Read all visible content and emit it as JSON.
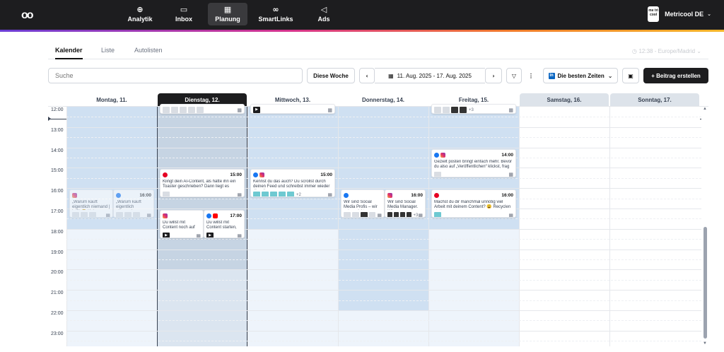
{
  "nav": {
    "items": [
      {
        "label": "Analytik",
        "icon": "analytics-icon",
        "glyph": "⊕"
      },
      {
        "label": "Inbox",
        "icon": "inbox-icon",
        "glyph": "▭"
      },
      {
        "label": "Planung",
        "icon": "calendar-icon",
        "glyph": "▦"
      },
      {
        "label": "SmartLinks",
        "icon": "link-icon",
        "glyph": "∞"
      },
      {
        "label": "Ads",
        "icon": "megaphone-icon",
        "glyph": "◁"
      }
    ],
    "active": "Planung"
  },
  "account": {
    "name": "Metricool DE",
    "logo_text": "me tri cool"
  },
  "tabs": [
    "Kalender",
    "Liste",
    "Autolisten"
  ],
  "timezone": "12:38 - Europe/Madrid",
  "toolbar": {
    "search_placeholder": "Suche",
    "this_week": "Diese Woche",
    "date_range": "11. Aug. 2025 - 17. Aug. 2025",
    "best_times": "Die besten Zeiten",
    "create_post": "+ Beitrag erstellen"
  },
  "days": [
    {
      "label": "Montag, 11.",
      "state": "normal"
    },
    {
      "label": "Dienstag, 12.",
      "state": "today"
    },
    {
      "label": "Mittwoch, 13.",
      "state": "normal"
    },
    {
      "label": "Donnerstag, 14.",
      "state": "normal"
    },
    {
      "label": "Freitag, 15.",
      "state": "normal"
    },
    {
      "label": "Samstag, 16.",
      "state": "weekend"
    },
    {
      "label": "Sonntag, 17.",
      "state": "weekend"
    }
  ],
  "hours": [
    "12:00",
    "13:00",
    "14:00",
    "15:00",
    "16:00",
    "17:00",
    "18:00",
    "19:00",
    "20:00",
    "21:00",
    "22:00",
    "23:00"
  ],
  "posts": [
    {
      "day": "Dienstag, 12.",
      "hour": "11:30",
      "networks": [],
      "time": "",
      "text": "",
      "thumbs": [
        "gray",
        "gray",
        "gray",
        "gray",
        "gray"
      ],
      "more": ""
    },
    {
      "day": "Mittwoch, 13.",
      "hour": "11:30",
      "networks": [],
      "time": "",
      "text": "",
      "thumbs": [
        "play"
      ],
      "more": ""
    },
    {
      "day": "Freitag, 15.",
      "hour": "11:30",
      "networks": [],
      "time": "",
      "text": "",
      "thumbs": [
        "gray",
        "gray",
        "dark",
        "dark"
      ],
      "more": "+3"
    },
    {
      "day": "Freitag, 15.",
      "hour": "14:00",
      "networks": [
        "fb",
        "ig"
      ],
      "time": "14:00",
      "text": "Gezielt posten bringt einfach mehr. Bevor du also auf „Veröffentlichen“ klickst, frag dich",
      "thumbs": [
        "gray"
      ],
      "more": ""
    },
    {
      "day": "Dienstag, 12.",
      "hour": "15:00",
      "networks": [
        "pin"
      ],
      "time": "15:00",
      "text": "Klingt dein AI-Content, als hätte ihn ein Toaster geschrieben? Dann liegt es",
      "thumbs": [
        "gray"
      ],
      "more": ""
    },
    {
      "day": "Mittwoch, 13.",
      "hour": "15:00",
      "networks": [
        "fb",
        "ig"
      ],
      "time": "15:00",
      "text": "Kennst du das auch? Du scrollst durch deinen Feed und schreibst immer wieder dieselben",
      "thumbs": [
        "teal",
        "teal",
        "teal",
        "teal",
        "teal"
      ],
      "more": "+2"
    },
    {
      "day": "Montag, 11.",
      "hour": "16:00",
      "networks": [
        "ig"
      ],
      "time": "",
      "text": "„Warum kauft eigentlich niemand | ist?“ 🤔 Kein",
      "thumbs": [
        "gray",
        "gray",
        "gray"
      ],
      "more": "",
      "faded": true,
      "half": "left"
    },
    {
      "day": "Montag, 11.",
      "hour": "16:00",
      "networks": [
        "fb"
      ],
      "time": "16:00",
      "text": "„Warum kauft eigentlich niemand",
      "thumbs": [
        "gray",
        "gray",
        "gray"
      ],
      "more": "",
      "faded": true,
      "half": "right"
    },
    {
      "day": "Donnerstag, 14.",
      "hour": "16:00",
      "networks": [
        "fb"
      ],
      "time": "",
      "text": "Wir sind Social Media Profis – wir retten nicht",
      "thumbs": [
        "gray",
        "gray",
        "dark",
        "gray"
      ],
      "more": "",
      "half": "left"
    },
    {
      "day": "Donnerstag, 14.",
      "hour": "16:00",
      "networks": [
        "ig"
      ],
      "time": "16:00",
      "text": "Wir sind Social Media Manager. Wir",
      "thumbs": [
        "dark",
        "dark",
        "dark",
        "dark"
      ],
      "more": "+3",
      "half": "right"
    },
    {
      "day": "Freitag, 15.",
      "hour": "16:00",
      "networks": [
        "pin"
      ],
      "time": "16:00",
      "text": "Machst du dir manchmal unnötig viel Arbeit mit deinem Content? 😩 Recyclen statt",
      "thumbs": [
        "teal"
      ],
      "more": ""
    },
    {
      "day": "Dienstag, 12.",
      "hour": "17:00",
      "networks": [
        "ig"
      ],
      "time": "",
      "text": "Du willst mit Content noch auf perfekte Sei",
      "thumbs": [
        "play"
      ],
      "more": "",
      "half": "left"
    },
    {
      "day": "Dienstag, 12.",
      "hour": "17:00",
      "networks": [
        "fb",
        "yt"
      ],
      "time": "17:00",
      "text": "Du willst mit Content starten, aber wartest",
      "thumbs": [
        "play"
      ],
      "more": "",
      "half": "right"
    }
  ],
  "colors": {
    "topbar": "#1d1d1f",
    "weekday_bg": "#e2ecf7",
    "best_time": "#cfe0f2",
    "weekend_bg": "#ffffff"
  }
}
